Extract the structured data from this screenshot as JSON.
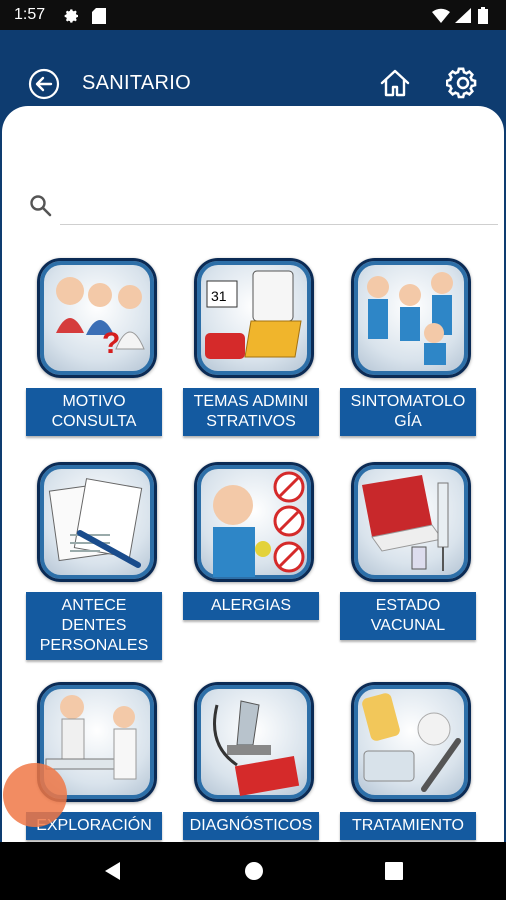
{
  "status_bar": {
    "time": "1:57",
    "icons": [
      "gear-icon",
      "sd-card-icon",
      "wifi-icon",
      "signal-icon",
      "battery-icon"
    ]
  },
  "app_bar": {
    "title": "SANITARIO",
    "back_icon": "arrow-left-circle-icon",
    "home_icon": "home-icon",
    "settings_icon": "gear-icon",
    "background": "#0e3c70"
  },
  "search": {
    "value": "",
    "placeholder": "",
    "icon": "search-icon"
  },
  "tiles": [
    {
      "label": "MOTIVO\nCONSULTA",
      "illustration": "doctor-patients-icon"
    },
    {
      "label": "TEMAS ADMINI\nSTRATIVOS",
      "illustration": "admin-folder-phone-icon"
    },
    {
      "label": "SINTOMATOLO\nGÍA",
      "illustration": "sick-people-icon"
    },
    {
      "label": "ANTECE\nDENTES\nPERSONALES",
      "illustration": "medical-forms-icon"
    },
    {
      "label": "ALERGIAS",
      "illustration": "allergy-sneeze-icon"
    },
    {
      "label": "ESTADO\nVACUNAL",
      "illustration": "vaccine-book-syringe-icon"
    },
    {
      "label": "EXPLORACIÓN",
      "illustration": "patient-exam-bed-icon"
    },
    {
      "label": "DIAGNÓSTICOS",
      "illustration": "microscope-stethoscope-icon"
    },
    {
      "label": "TRATAMIENTO",
      "illustration": "pills-syringe-icon"
    }
  ],
  "colors": {
    "accent": "#145aa0",
    "tile_border": "#0b2b55",
    "touch_indicator": "#f07846"
  },
  "nav_bar": {
    "icons": [
      "nav-back-icon",
      "nav-home-icon",
      "nav-recents-icon"
    ]
  }
}
